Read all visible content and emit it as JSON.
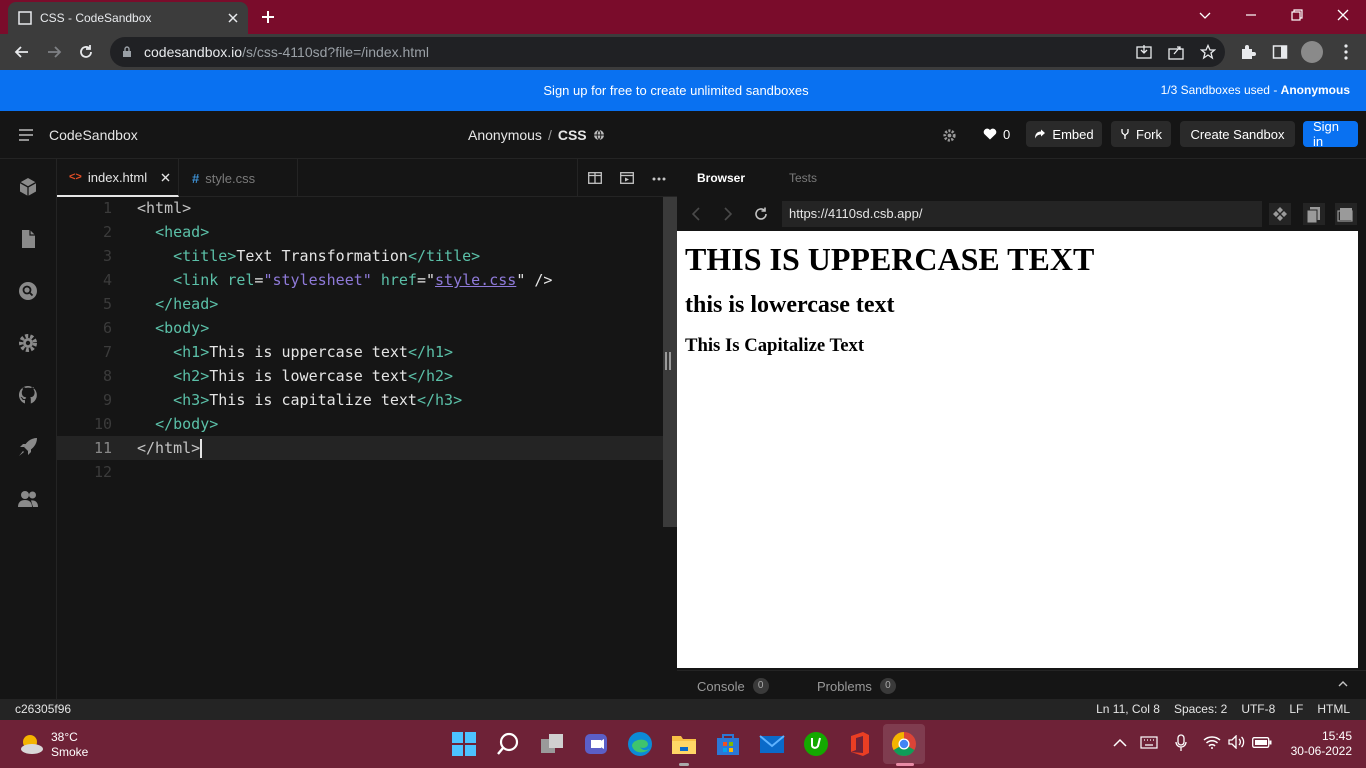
{
  "browser": {
    "tab_title": "CSS - CodeSandbox",
    "url_host": "codesandbox.io",
    "url_path": "/s/css-4110sd?file=/index.html"
  },
  "banner": {
    "text": "Sign up for free to create unlimited sandboxes",
    "usage_prefix": "1/3 Sandboxes used - ",
    "usage_user": "Anonymous"
  },
  "header": {
    "brand": "CodeSandbox",
    "owner": "Anonymous",
    "separator": "/",
    "sandbox": "CSS",
    "likes": "0",
    "embed": "Embed",
    "fork": "Fork",
    "create": "Create Sandbox",
    "signin": "Sign in"
  },
  "editor": {
    "tabs": [
      {
        "label": "index.html",
        "active": true
      },
      {
        "label": "style.css",
        "active": false
      }
    ],
    "line_numbers": [
      "1",
      "2",
      "3",
      "4",
      "5",
      "6",
      "7",
      "8",
      "9",
      "10",
      "11",
      "12"
    ],
    "code": {
      "l1": "<html>",
      "l2_indent": "  ",
      "l2": "<head>",
      "l3_indent": "    ",
      "l3_open": "<title>",
      "l3_text": "Text Transformation",
      "l3_close": "</title>",
      "l4_indent": "    ",
      "l4_tag": "<link",
      "l4_attr1": "rel",
      "l4_val1": "\"stylesheet\"",
      "l4_attr2": "href",
      "l4_val2": "style.css",
      "l4_end": " />",
      "l5_indent": "  ",
      "l5": "</head>",
      "l6_indent": "  ",
      "l6": "<body>",
      "l7_indent": "    ",
      "l7_open": "<h1>",
      "l7_text": "This is uppercase text",
      "l7_close": "</h1>",
      "l8_indent": "    ",
      "l8_open": "<h2>",
      "l8_text": "This is lowercase text",
      "l8_close": "</h2>",
      "l9_indent": "    ",
      "l9_open": "<h3>",
      "l9_text": "This is capitalize text",
      "l9_close": "</h3>",
      "l10_indent": "  ",
      "l10": "</body>",
      "l11": "</html>"
    }
  },
  "preview": {
    "tabs": [
      "Browser",
      "Tests"
    ],
    "url": "https://4110sd.csb.app/",
    "h1": "This is uppercase text",
    "h2": "This is lowercase text",
    "h3": "This is capitalize text",
    "console_label": "Console",
    "console_count": "0",
    "problems_label": "Problems",
    "problems_count": "0"
  },
  "status": {
    "commit": "c26305f96",
    "position": "Ln 11, Col 8",
    "spaces": "Spaces: 2",
    "encoding": "UTF-8",
    "eol": "LF",
    "language": "HTML"
  },
  "taskbar": {
    "temp": "38°C",
    "weather": "Smoke",
    "time": "15:45",
    "date": "30-06-2022"
  }
}
